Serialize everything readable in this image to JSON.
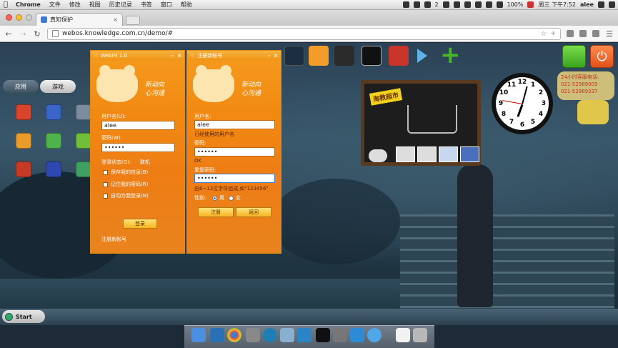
{
  "menubar": {
    "app_name": "Chrome",
    "items": [
      "文件",
      "修改",
      "视图",
      "历史记录",
      "书签",
      "窗口",
      "帮助"
    ],
    "status_right": {
      "battery": "100%",
      "clock": "周三 下午7:52",
      "user": "alee",
      "badge_count": "2"
    }
  },
  "browser": {
    "tab_title": "真知保护",
    "url": "webos.knowledge.com.cn/demo/#"
  },
  "launcher": {
    "tab_apps": "应用",
    "tab_games": "游戏"
  },
  "login_dialog": {
    "title": "WebIM 1.0",
    "slogan_line1": "新动向",
    "slogan_line2": "心沟通",
    "username_label": "用户名(U):",
    "username_value": "alee",
    "password_label": "密码(W):",
    "password_value": "••••••",
    "status_label": "登录状态(G):",
    "status_value": "联机",
    "save_info_label": "保存我的信息(B)",
    "remember_pw_label": "记住我的密码(R)",
    "auto_login_label": "自动为我登录(N)",
    "login_button": "登录",
    "register_link": "注册新帐号"
  },
  "register_dialog": {
    "title": "注册新帐号",
    "slogan_line1": "新动向",
    "slogan_line2": "心沟通",
    "username_label": "用户名:",
    "username_value": "alee",
    "username_note": "已经使用的用户名",
    "password_label": "密码:",
    "password_value": "••••••",
    "password_note": "OK",
    "confirm_label": "重复密码:",
    "confirm_value": "••••••",
    "confirm_note": "由6~12位字符组成,如\"123456\"",
    "gender_label": "性别:",
    "gender_male": "男",
    "gender_female": "女",
    "register_button": "注册",
    "back_button": "返回"
  },
  "board": {
    "title": "淘教超市"
  },
  "hotline": {
    "title": "24小时客服电话:",
    "phone1": "021-52989009",
    "phone2": "021-52989337"
  },
  "clock_numbers": [
    "12",
    "1",
    "2",
    "3",
    "4",
    "5",
    "6",
    "7",
    "8",
    "9",
    "10",
    "11"
  ],
  "taskbar": {
    "start_label": "Start"
  },
  "colors": {
    "dialog_orange": "#f28a12",
    "menubar_bg": "#e6e6e6",
    "accent_blue": "#3a7bd5"
  }
}
